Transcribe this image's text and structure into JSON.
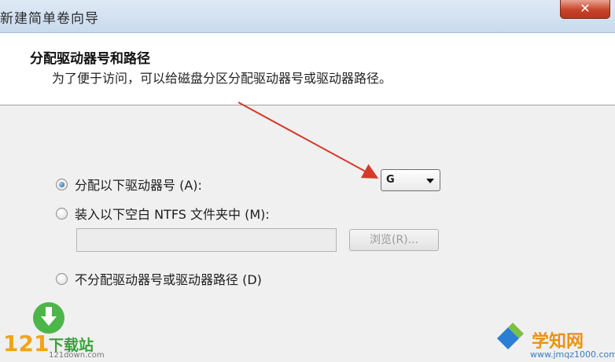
{
  "window": {
    "title": "新建简单卷向导",
    "close_label": "✕"
  },
  "header": {
    "title": "分配驱动器号和路径",
    "subtitle": "为了便于访问，可以给磁盘分区分配驱动器号或驱动器路径。"
  },
  "options": {
    "assign_letter": "分配以下驱动器号 (A):",
    "mount_folder": "装入以下空白 NTFS 文件夹中 (M):",
    "no_assign": "不分配驱动器号或驱动器路径 (D)"
  },
  "drive_letter": {
    "selected": "G"
  },
  "folder_path": {
    "value": "",
    "browse_label": "浏览(R)..."
  },
  "watermarks": {
    "left_number": "121",
    "left_word": "下载站",
    "left_site": "121down.com",
    "right_name": "学知网",
    "right_site": "www.jmqz1000.com"
  },
  "colors": {
    "arrow": "#d43a2a",
    "accent_blue": "#1f5d99"
  }
}
